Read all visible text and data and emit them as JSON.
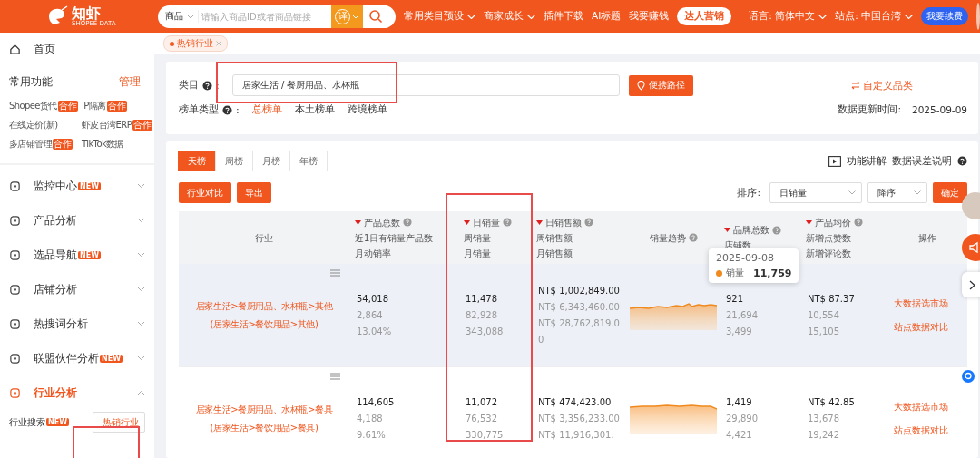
{
  "topbar": {
    "logo": "知虾",
    "logo_sub": "SHOPEE DATA",
    "search": {
      "type": "商品",
      "placeholder": "请输入商品ID或者商品链接",
      "translate": "译"
    },
    "nav": [
      {
        "label": "常用类目预设",
        "dropdown": true
      },
      {
        "label": "商家成长",
        "dropdown": true
      },
      {
        "label": "插件下载",
        "dropdown": false
      },
      {
        "label": "AI标题",
        "dropdown": false
      },
      {
        "label": "我要赚钱",
        "dropdown": false
      }
    ],
    "talent": "达人营销",
    "language": "语言: 简体中文",
    "site": "站点: 中国台湾",
    "renew": "我要续费"
  },
  "sidebar": {
    "home": "首页",
    "common_title": "常用功能",
    "manage": "管理",
    "shortcuts": [
      {
        "label": "Shopee货代",
        "badge": "合作"
      },
      {
        "label": "IP隔离",
        "badge": "合作"
      },
      {
        "label": "在线定价(新)"
      },
      {
        "label": "虾皮台湾ERP",
        "badge": "合作"
      },
      {
        "label": "多店铺管理",
        "badge": "合作"
      },
      {
        "label": "TikTok数据"
      }
    ],
    "menu": [
      {
        "label": "监控中心",
        "badge": "NEW",
        "expanded": false
      },
      {
        "label": "产品分析",
        "expanded": false
      },
      {
        "label": "选品导航",
        "badge": "NEW",
        "expanded": false
      },
      {
        "label": "店铺分析",
        "expanded": false
      },
      {
        "label": "热搜词分析",
        "expanded": false
      },
      {
        "label": "联盟伙伴分析",
        "badge": "NEW",
        "expanded": false
      },
      {
        "label": "行业分析",
        "expanded": true,
        "children": [
          {
            "label": "行业搜索",
            "badge": "NEW",
            "selected": false
          },
          {
            "label": "热销行业",
            "selected": true
          }
        ]
      }
    ]
  },
  "open_tabs": [
    {
      "label": "热销行业",
      "selected": true
    }
  ],
  "filter": {
    "colon": ":",
    "category_label": "类目",
    "category_value": "居家生活 / 餐厨用品、水杯瓶",
    "path_button": "便携路径",
    "custom": "自定义品类",
    "rank_type_label": "榜单类型",
    "rank_types": [
      {
        "label": "总榜单",
        "selected": true
      },
      {
        "label": "本土榜单",
        "selected": false
      },
      {
        "label": "跨境榜单",
        "selected": false
      }
    ],
    "update_label": "数据更新时间:",
    "update_value": "2025-09-09"
  },
  "table_card": {
    "periods": [
      {
        "label": "天榜",
        "selected": true
      },
      {
        "label": "周榜",
        "selected": false
      },
      {
        "label": "月榜",
        "selected": false
      },
      {
        "label": "年榜",
        "selected": false
      }
    ],
    "buttons": [
      "行业对比",
      "导出"
    ],
    "links": [
      "功能讲解",
      "数据误差说明"
    ],
    "sort_label": "排序:",
    "sort_field": "日销量",
    "sort_order": "降序",
    "confirm": "确定"
  },
  "columns": [
    {
      "lines": [
        "行业"
      ],
      "sortable": false,
      "help": false
    },
    {
      "lines": [
        "产品总数",
        "近1日有销量产品数",
        "月动销率"
      ],
      "sortable": true,
      "help": true
    },
    {
      "lines": [
        "日销量",
        "周销量",
        "月销量"
      ],
      "sortable": true,
      "help": true
    },
    {
      "lines": [
        "日销售额",
        "周销售额",
        "月销售额"
      ],
      "sortable": true,
      "help": true
    },
    {
      "lines": [
        "销量趋势"
      ],
      "sortable": false,
      "help": true
    },
    {
      "lines": [
        "品牌总数",
        "店铺数"
      ],
      "sortable": true,
      "help": true
    },
    {
      "lines": [
        "产品均价",
        "新增点赞数",
        "新增评论数"
      ],
      "sortable": true,
      "help": true
    },
    {
      "lines": [
        "操作"
      ],
      "sortable": false,
      "help": false
    }
  ],
  "rows": [
    {
      "highlighted": true,
      "category": "居家生活>餐厨用品、水杯瓶>其他",
      "category_local": "(居家生活>餐饮用品>其他)",
      "products": [
        "54,018",
        "2,864",
        "13.04%"
      ],
      "sales": [
        "11,478",
        "82,928",
        "343,088"
      ],
      "revenue": [
        "NT$ 1,002,849.00",
        "NT$ 6,343,460.00",
        "NT$ 28,762,819.00"
      ],
      "brands": [
        "921",
        "21,694",
        "3,499"
      ],
      "price": [
        "NT$ 87.37",
        "10,554",
        "15,105"
      ],
      "actions": [
        "大数据选市场",
        "站点数据对比"
      ]
    },
    {
      "highlighted": false,
      "category": "居家生活>餐厨用品、水杯瓶>餐具",
      "category_local": "(居家生活>餐饮用品>餐具)",
      "products": [
        "114,605",
        "4,188",
        "9.61%"
      ],
      "sales": [
        "11,072",
        "76,532",
        "330,775"
      ],
      "revenue": [
        "NT$ 474,423.00",
        "NT$ 3,356,233.00",
        "NT$ 11,916,301."
      ],
      "brands": [
        "1,419",
        "29,890",
        "4,421"
      ],
      "price": [
        "NT$ 42.85",
        "13,678",
        "19,242"
      ],
      "actions": [
        "大数据选市场",
        "站点数据对比"
      ]
    }
  ],
  "tooltip": {
    "date": "2025-09-08",
    "series": "销量",
    "value": "11,759"
  }
}
